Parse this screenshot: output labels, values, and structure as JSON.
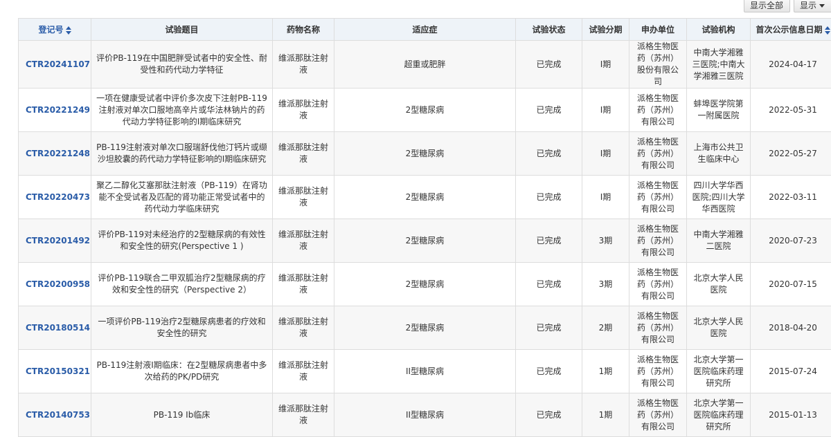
{
  "toolbar": {
    "show_all": "显示全部",
    "show": "显示"
  },
  "columns": [
    "登记号",
    "试验题目",
    "药物名称",
    "适应症",
    "试验状态",
    "试验分期",
    "申办单位",
    "试验机构",
    "首次公示信息日期"
  ],
  "rows": [
    {
      "reg": "CTR20241107",
      "title": "评价PB-119在中国肥胖受试者中的安全性、耐受性和药代动力学特征",
      "drug": "维派那肽注射液",
      "indication": "超重或肥胖",
      "status": "已完成",
      "phase": "I期",
      "sponsor": "派格生物医药（苏州）股份有限公司",
      "site": "中南大学湘雅三医院;中南大学湘雅三医院",
      "date": "2024-04-17"
    },
    {
      "reg": "CTR20221249",
      "title": "一项在健康受试者中评价多次皮下注射PB-119注射液对单次口服地高辛片或华法林钠片的药代动力学特征影响的I期临床研究",
      "drug": "维派那肽注射液",
      "indication": "2型糖尿病",
      "status": "已完成",
      "phase": "I期",
      "sponsor": "派格生物医药（苏州）有限公司",
      "site": "蚌埠医学院第一附属医院",
      "date": "2022-05-31"
    },
    {
      "reg": "CTR20221248",
      "title": "PB-119注射液对单次口服瑞舒伐他汀钙片或缬沙坦胶囊的药代动力学特征影响的I期临床研究",
      "drug": "维派那肽注射液",
      "indication": "2型糖尿病",
      "status": "已完成",
      "phase": "I期",
      "sponsor": "派格生物医药（苏州）有限公司",
      "site": "上海市公共卫生临床中心",
      "date": "2022-05-27"
    },
    {
      "reg": "CTR20220473",
      "title": "聚乙二醇化艾塞那肽注射液（PB-119）在肾功能不全受试者及匹配的肾功能正常受试者中的药代动力学临床研究",
      "drug": "维派那肽注射液",
      "indication": "2型糖尿病",
      "status": "已完成",
      "phase": "I期",
      "sponsor": "派格生物医药（苏州）有限公司",
      "site": "四川大学华西医院;四川大学华西医院",
      "date": "2022-03-11"
    },
    {
      "reg": "CTR20201492",
      "title": "评价PB-119对未经治疗的2型糖尿病的有效性和安全性的研究(Perspective 1 )",
      "drug": "维派那肽注射液",
      "indication": "2型糖尿病",
      "status": "已完成",
      "phase": "3期",
      "sponsor": "派格生物医药（苏州）有限公司",
      "site": "中南大学湘雅二医院",
      "date": "2020-07-23"
    },
    {
      "reg": "CTR20200958",
      "title": "评价PB-119联合二甲双胍治疗2型糖尿病的疗效和安全性的研究（Perspective 2）",
      "drug": "维派那肽注射液",
      "indication": "2型糖尿病",
      "status": "已完成",
      "phase": "3期",
      "sponsor": "派格生物医药（苏州）有限公司",
      "site": "北京大学人民医院",
      "date": "2020-07-15"
    },
    {
      "reg": "CTR20180514",
      "title": "一项评价PB-119治疗2型糖尿病患者的疗效和安全性的研究",
      "drug": "维派那肽注射液",
      "indication": "2型糖尿病",
      "status": "已完成",
      "phase": "2期",
      "sponsor": "派格生物医药（苏州）有限公司",
      "site": "北京大学人民医院",
      "date": "2018-04-20"
    },
    {
      "reg": "CTR20150321",
      "title": "PB-119注射液I期临床：在2型糖尿病患者中多次给药的PK/PD研究",
      "drug": "维派那肽注射液",
      "indication": "II型糖尿病",
      "status": "已完成",
      "phase": "1期",
      "sponsor": "派格生物医药（苏州）有限公司",
      "site": "北京大学第一医院临床药理研究所",
      "date": "2015-07-24"
    },
    {
      "reg": "CTR20140753",
      "title": "PB-119 Ib临床",
      "drug": "维派那肽注射液",
      "indication": "II型糖尿病",
      "status": "已完成",
      "phase": "1期",
      "sponsor": "派格生物医药（苏州）有限公司",
      "site": "北京大学第一医院临床药理研究所",
      "date": "2015-01-13"
    }
  ]
}
